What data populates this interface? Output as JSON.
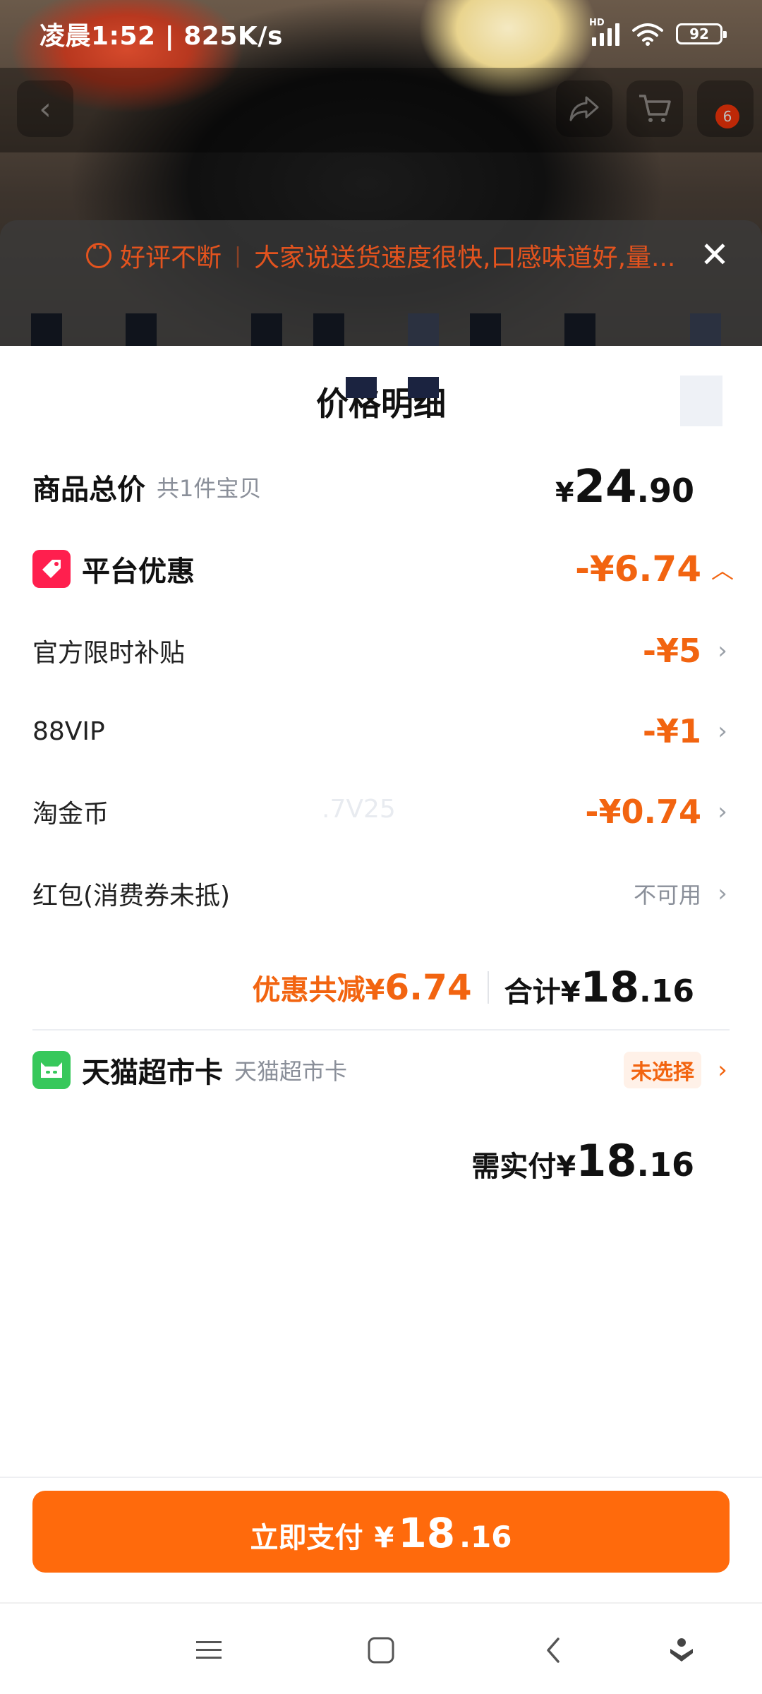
{
  "status_bar": {
    "time_speed": "凌晨1:52 | 825K/s",
    "hd_label": "HD",
    "battery": "92"
  },
  "top_nav": {
    "cart_badge": "6"
  },
  "review_banner": {
    "tag": "好评不断",
    "text": "大家说送货速度很快,口感味道好,量..."
  },
  "sheet": {
    "title": "价格明细"
  },
  "goods_total": {
    "label": "商品总价",
    "sub": "共1件宝贝",
    "yen": "¥",
    "int": "24",
    "dec": ".90"
  },
  "platform_discount": {
    "label": "平台优惠",
    "value": "-¥6.74"
  },
  "discount_items": [
    {
      "label": "官方限时补贴",
      "value": "-¥5"
    },
    {
      "label": "88VIP",
      "value": "-¥1"
    },
    {
      "label": "淘金币",
      "value": "-¥0.74"
    }
  ],
  "red_packet": {
    "label": "红包(消费券未抵)",
    "value": "不可用"
  },
  "watermark": ".7V25",
  "summary": {
    "saved_label": "优惠共减",
    "saved_yen": "¥",
    "saved_amount": "6.74",
    "total_label": "合计",
    "total_yen": "¥",
    "total_int": "18",
    "total_dec": ".16"
  },
  "tmall_card": {
    "label": "天猫超市卡",
    "sub": "天猫超市卡",
    "status": "未选择"
  },
  "need_pay": {
    "label": "需实付",
    "yen": "¥",
    "int": "18",
    "dec": ".16"
  },
  "pay_button": {
    "label": "立即支付",
    "yen": "¥",
    "int": "18",
    "dec": ".16"
  },
  "colors": {
    "accent_orange": "#f26410",
    "pay_button": "#ff6a0c",
    "tag_red": "#ff1f4e",
    "cat_green": "#37c85b"
  }
}
